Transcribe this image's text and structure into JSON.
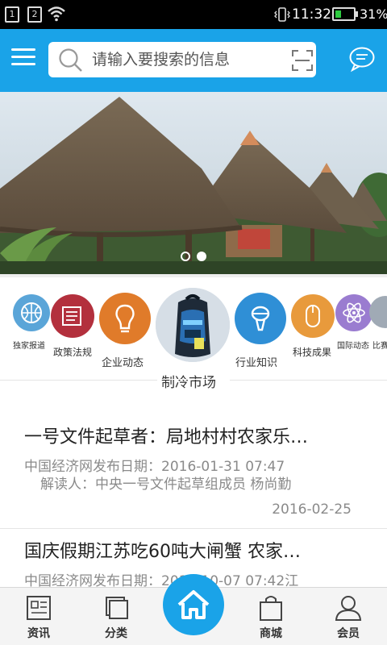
{
  "status_bar": {
    "sim1": "1",
    "sim2": "2",
    "time": "11:32",
    "battery": "31%",
    "battery_level": 0.31
  },
  "header": {
    "search_placeholder": "请输入要搜索的信息"
  },
  "banner": {
    "slide_count": 2,
    "active_slide": 2
  },
  "categories": [
    {
      "label": "独家报道",
      "icon": "basketball-icon",
      "color": "#3a8fc8"
    },
    {
      "label": "政策法规",
      "icon": "document-icon",
      "color": "#b3303d"
    },
    {
      "label": "企业动态",
      "icon": "lightbulb-icon",
      "color": "#e07b2a"
    },
    {
      "label": "制冷市场",
      "icon": "backpack-image",
      "color": "#2a6fb3"
    },
    {
      "label": "行业知识",
      "icon": "microphone-icon",
      "color": "#2f8fd6"
    },
    {
      "label": "科技成果",
      "icon": "mouse-icon",
      "color": "#e89a3c"
    },
    {
      "label": "国际动态",
      "icon": "atom-icon",
      "color": "#8d6cc2"
    },
    {
      "label": "比赛",
      "icon": "gray-icon",
      "color": "#a0aab5"
    }
  ],
  "news": [
    {
      "title": "一号文件起草者：局地村村农家乐…",
      "meta_line1": "中国经济网发布日期：2016-01-31 07:47",
      "meta_line2": "解读人：中央一号文件起草组成员 杨尚勤",
      "date": "2016-02-25"
    },
    {
      "title": "国庆假期江苏吃60吨大闸蟹 农家…",
      "meta_line1": "中国经济网发布日期：2015-10-07 07:42江"
    }
  ],
  "tabbar": {
    "news_label": "资讯",
    "category_label": "分类",
    "mall_label": "商城",
    "member_label": "会员"
  },
  "colors": {
    "accent": "#1aa3e8"
  }
}
